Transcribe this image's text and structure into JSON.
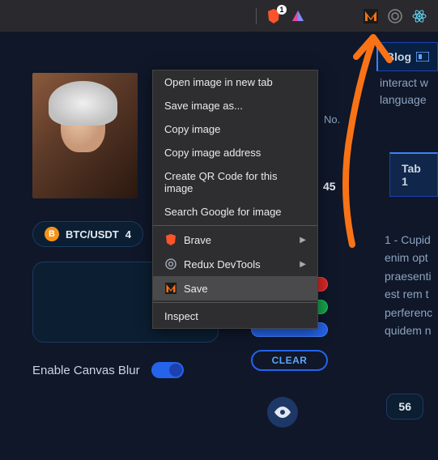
{
  "topbar": {
    "brave_count": "1"
  },
  "blog_button": {
    "label": "Blog"
  },
  "side_text": {
    "line1": "interact w",
    "line2": "language"
  },
  "tab": {
    "label": "Tab 1"
  },
  "portrait": {
    "alt": "classical portrait painting"
  },
  "btc": {
    "icon": "B",
    "pair": "BTC/USDT",
    "price_fragment": "4"
  },
  "context_menu": {
    "items": [
      {
        "label": "Open image in new tab",
        "icon": null,
        "submenu": false
      },
      {
        "label": "Save image as...",
        "icon": null,
        "submenu": false
      },
      {
        "label": "Copy image",
        "icon": null,
        "submenu": false
      },
      {
        "label": "Copy image address",
        "icon": null,
        "submenu": false
      },
      {
        "label": "Create QR Code for this image",
        "icon": null,
        "submenu": false
      },
      {
        "label": "Search Google for image",
        "icon": null,
        "submenu": false
      }
    ],
    "ext_items": [
      {
        "label": "Brave",
        "icon": "brave",
        "submenu": true
      },
      {
        "label": "Redux DevTools",
        "icon": "redux",
        "submenu": true
      },
      {
        "label": "Save",
        "icon": "save-m",
        "submenu": false,
        "hover": true
      }
    ],
    "inspect": {
      "label": "Inspect"
    }
  },
  "right": {
    "no_label": "No.",
    "num": "45"
  },
  "clear_button": {
    "label": "CLEAR"
  },
  "toggle": {
    "label": "Enable Canvas Blur"
  },
  "lorem": {
    "line1": "1 - Cupid",
    "line2": "enim opt",
    "line3": "praesenti",
    "line4": "est rem t",
    "line5": "perferenc",
    "line6": "quidem n"
  },
  "badge": {
    "value": "56"
  }
}
